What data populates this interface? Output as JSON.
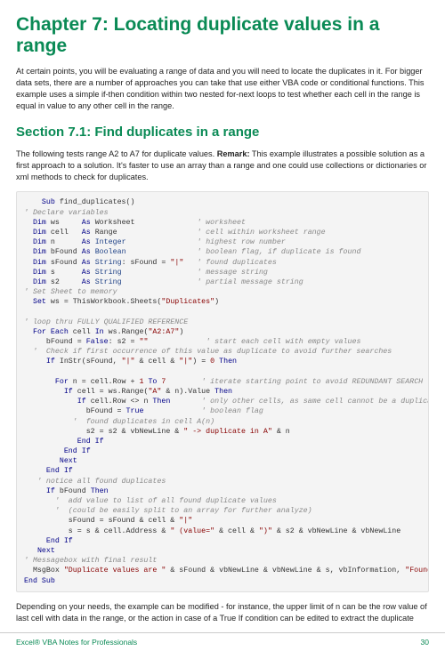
{
  "chapter_title": "Chapter 7: Locating duplicate values in a range",
  "intro_para": "At certain points, you will be evaluating a range of data and you will need to locate the duplicates in it. For bigger data sets, there are a number of approaches you can take that use either VBA code or conditional functions. This example uses a simple if-then condition within two nested for-next loops to test whether each cell in the range is equal in value to any other cell in the range.",
  "section_title": "Section 7.1: Find duplicates in a range",
  "section_para_prefix": "The following tests range A2 to A7 for duplicate values. ",
  "section_para_bold": "Remark:",
  "section_para_suffix": " This example illustrates a possible solution as a first approach to a solution. It's faster to use an array than a range and one could use collections or dictionaries or xml methods to check for duplicates.",
  "closing_para": "Depending on your needs, the example can be modified - for instance, the upper limit of n can be the row value of last cell with data in the range, or the action in case of a True If condition can be edited to extract the duplicate",
  "footer_left": "Excel® VBA Notes for Professionals",
  "footer_right": "30",
  "code": {
    "l1a": "Sub",
    "l1b": " find_duplicates()",
    "l2": "' Declare variables",
    "l3a": "Dim",
    "l3b": " ws     ",
    "l3c": "As",
    "l3d": " Worksheet              ",
    "l3e": "' worksheet",
    "l4a": "Dim",
    "l4b": " cell   ",
    "l4c": "As",
    "l4d": " Range                  ",
    "l4e": "' cell within worksheet range",
    "l5a": "Dim",
    "l5b": " n      ",
    "l5c": "As",
    "l5d": " ",
    "l5e": "Integer",
    "l5f": "                ",
    "l5g": "' highest row number",
    "l6a": "Dim",
    "l6b": " bFound ",
    "l6c": "As",
    "l6d": " ",
    "l6e": "Boolean",
    "l6f": "                ",
    "l6g": "' boolean flag, if duplicate is found",
    "l7a": "Dim",
    "l7b": " sFound ",
    "l7c": "As",
    "l7d": " ",
    "l7e": "String",
    "l7f": ": sFound = ",
    "l7g": "\"|\"",
    "l7h": "   ",
    "l7i": "' found duplicates",
    "l8a": "Dim",
    "l8b": " s      ",
    "l8c": "As",
    "l8d": " ",
    "l8e": "String",
    "l8f": "                 ",
    "l8g": "' message string",
    "l9a": "Dim",
    "l9b": " s2     ",
    "l9c": "As",
    "l9d": " ",
    "l9e": "String",
    "l9f": "                 ",
    "l9g": "' partial message string",
    "l10": "' Set Sheet to memory",
    "l11a": "Set",
    "l11b": " ws = ThisWorkbook.Sheets(",
    "l11c": "\"Duplicates\"",
    "l11d": ")",
    "l12": "",
    "l13": "' loop thru FULLY QUALIFIED REFERENCE",
    "l14a": "For",
    "l14b": " ",
    "l14c": "Each",
    "l14d": " cell ",
    "l14e": "In",
    "l14f": " ws.Range(",
    "l14g": "\"A2:A7\"",
    "l14h": ")",
    "l15a": "     bFound = ",
    "l15b": "False",
    "l15c": ": s2 = ",
    "l15d": "\"\"",
    "l15e": "             ",
    "l15f": "' start each cell with empty values",
    "l16": "'  Check if first occurrence of this value as duplicate to avoid further searches",
    "l17a": "If",
    "l17b": " InStr(sFound, ",
    "l17c": "\"|\"",
    "l17d": " & cell & ",
    "l17e": "\"|\"",
    "l17f": ") = ",
    "l17g": "0",
    "l17h": " ",
    "l17i": "Then",
    "l18": "",
    "l19a": "For",
    "l19b": " n = cell.Row + ",
    "l19c": "1",
    "l19d": " ",
    "l19e": "To",
    "l19f": " ",
    "l19g": "7",
    "l19h": "        ",
    "l19i": "' iterate starting point to avoid REDUNDANT SEARCH",
    "l20a": "If",
    "l20b": " cell = ws.Range(",
    "l20c": "\"A\"",
    "l20d": " & n).Value ",
    "l20e": "Then",
    "l21a": "If",
    "l21b": " cell.Row <> n ",
    "l21c": "Then",
    "l21d": "       ",
    "l21e": "' only other cells, as same cell cannot be a duplicate",
    "l22a": "              bFound = ",
    "l22b": "True",
    "l22c": "             ",
    "l22d": "' boolean flag",
    "l23": "           '  found duplicates in cell A(n)",
    "l24a": "              s2 = s2 & vbNewLine & ",
    "l24b": "\" -> duplicate in A\"",
    "l24c": " & n",
    "l25a": "End",
    "l25b": " ",
    "l25c": "If",
    "l26a": "End",
    "l26b": " ",
    "l26c": "If",
    "l27": "Next",
    "l28a": "End",
    "l28b": " ",
    "l28c": "If",
    "l29": "   ' notice all found duplicates",
    "l30a": "If",
    "l30b": " bFound ",
    "l30c": "Then",
    "l31": "       '  add value to list of all found duplicate values",
    "l32": "       '  (could be easily split to an array for further analyze)",
    "l33a": "          sFound = sFound & cell & ",
    "l33b": "\"|\"",
    "l34a": "          s = s & cell.Address & ",
    "l34b": "\" (value=\"",
    "l34c": " & cell & ",
    "l34d": "\")\"",
    "l34e": " & s2 & vbNewLine & vbNewLine",
    "l35a": "End",
    "l35b": " ",
    "l35c": "If",
    "l36": "Next",
    "l37": "' Messagebox with final result",
    "l38a": "  MsgBox ",
    "l38b": "\"Duplicate values are \"",
    "l38c": " & sFound & vbNewLine & vbNewLine & s, vbInformation, ",
    "l38d": "\"Found duplicates\"",
    "l39a": "End",
    "l39b": " ",
    "l39c": "Sub"
  }
}
